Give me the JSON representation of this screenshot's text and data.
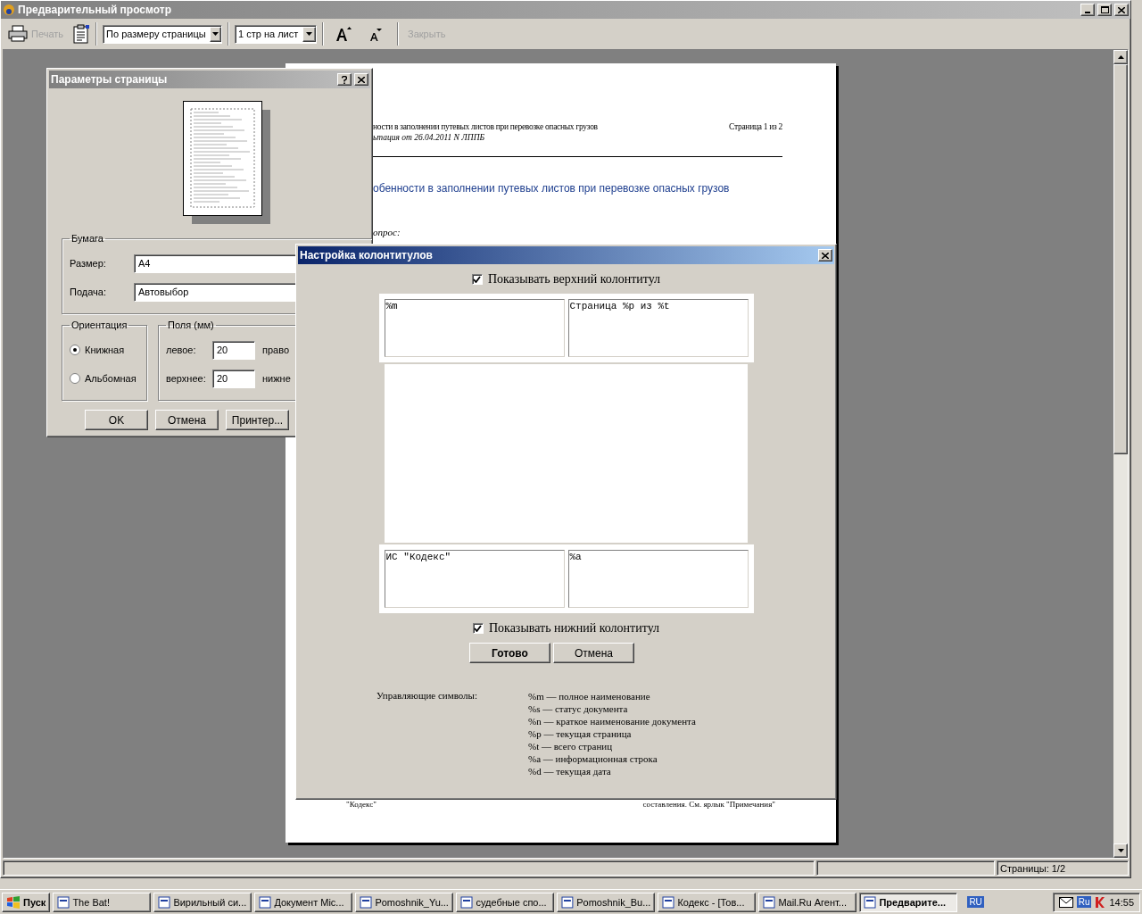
{
  "window": {
    "title": "Предварительный просмотр"
  },
  "toolbar": {
    "print": {
      "label": "Печать",
      "disabled": true
    },
    "zoom_select": "По размеру страницы",
    "pages_select": "1 стр на лист",
    "close": {
      "label": "Закрыть",
      "disabled": true
    }
  },
  "document": {
    "header_left": "ности в заполнении путевых листов при перевозке опасных грузов",
    "header_right": "Страница 1 из 2",
    "header_sub": "ьтация от 26.04.2011 N ЛППБ",
    "title": "обенности в заполнении путевых листов при перевозке опасных грузов",
    "question": "опрос:",
    "footer_left": "\"Кодекс\"",
    "footer_right": "составления. См. ярлык \"Примечания\""
  },
  "page_setup": {
    "title": "Параметры страницы",
    "paper_legend": "Бумага",
    "size_label": "Размер:",
    "size_value": "A4",
    "source_label": "Подача:",
    "source_value": "Автовыбор",
    "orientation_legend": "Ориентация",
    "orientations": [
      {
        "label": "Книжная",
        "selected": true
      },
      {
        "label": "Альбомная",
        "selected": false
      }
    ],
    "margins_legend": "Поля (мм)",
    "margins": [
      {
        "label": "левое:",
        "value": "20",
        "side_label": "право"
      },
      {
        "label": "верхнее:",
        "value": "20",
        "side_label": "нижне"
      }
    ],
    "buttons": [
      "OK",
      "Отмена",
      "Принтер..."
    ]
  },
  "header_footer": {
    "title": "Настройка колонтитулов",
    "show_header": {
      "label": "Показывать верхний колонтитул",
      "checked": true
    },
    "header_fields": [
      "%m",
      "Страница %p из %t"
    ],
    "footer_fields": [
      "ИС \"Кодекс\"",
      "%a"
    ],
    "show_footer": {
      "label": "Показывать нижний колонтитул",
      "checked": true
    },
    "buttons": [
      "Готово",
      "Отмена"
    ],
    "symbols_label": "Управляющие символы:",
    "symbols": [
      "%m — полное наименование",
      "%s — статус документа",
      "%n — краткое наименование документа",
      "%p — текущая страница",
      "%t — всего страниц",
      "%a — информационная строка",
      "%d — текущая дата"
    ]
  },
  "status_bar": {
    "pages": "Страницы: 1/2"
  },
  "taskbar": {
    "start": "Пуск",
    "tasks": [
      {
        "label": "The Bat!",
        "selected": false
      },
      {
        "label": "Вирильный си...",
        "selected": false
      },
      {
        "label": "Документ Mic...",
        "selected": false
      },
      {
        "label": "Pomoshnik_Yu...",
        "selected": false
      },
      {
        "label": "судебные спо...",
        "selected": false
      },
      {
        "label": "Pomoshnik_Bu...",
        "selected": false
      },
      {
        "label": "Кодекс - [Тов...",
        "selected": false
      },
      {
        "label": "Mail.Ru Агент...",
        "selected": false
      },
      {
        "label": "Предварите...",
        "selected": true
      }
    ],
    "language": "RU",
    "tray_language": "Ru",
    "time": "14:55"
  }
}
